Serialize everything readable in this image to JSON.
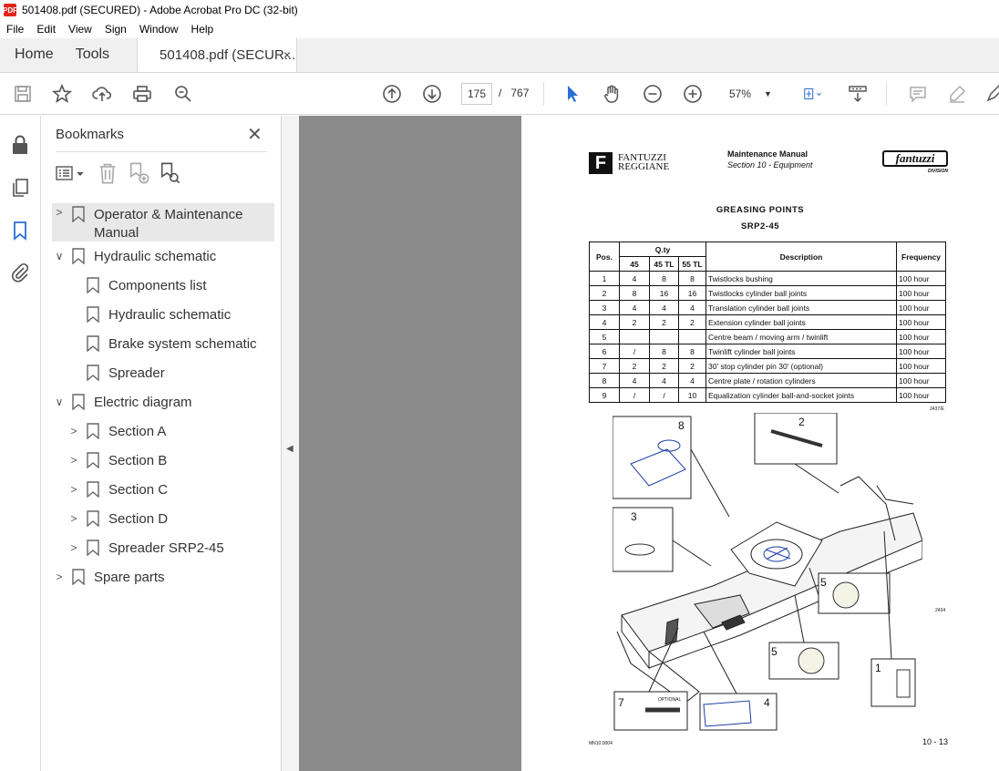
{
  "window": {
    "title": "501408.pdf (SECURED) - Adobe Acrobat Pro DC (32-bit)",
    "logo_text": "PDF"
  },
  "menu": [
    "File",
    "Edit",
    "View",
    "Sign",
    "Window",
    "Help"
  ],
  "tabs": {
    "home": "Home",
    "tools": "Tools",
    "document": "501408.pdf (SECUR...",
    "close": "×"
  },
  "toolbar": {
    "current_page": "175",
    "page_separator": "/",
    "total_pages": "767",
    "zoom": "57%"
  },
  "bookmarks_panel": {
    "title": "Bookmarks",
    "close": "✕",
    "items": [
      {
        "label": "Operator & Maintenance Manual",
        "level": 0,
        "expander": "collapsed",
        "selected": true
      },
      {
        "label": "Hydraulic schematic",
        "level": 0,
        "expander": "expanded",
        "selected": false
      },
      {
        "label": "Components list",
        "level": 1,
        "expander": "none",
        "selected": false
      },
      {
        "label": "Hydraulic schematic",
        "level": 1,
        "expander": "none",
        "selected": false
      },
      {
        "label": "Brake system schematic",
        "level": 1,
        "expander": "none",
        "selected": false
      },
      {
        "label": "Spreader",
        "level": 1,
        "expander": "none",
        "selected": false
      },
      {
        "label": "Electric diagram",
        "level": 0,
        "expander": "expanded",
        "selected": false
      },
      {
        "label": "Section A",
        "level": 1,
        "expander": "collapsed",
        "selected": false
      },
      {
        "label": "Section B",
        "level": 1,
        "expander": "collapsed",
        "selected": false
      },
      {
        "label": "Section C",
        "level": 1,
        "expander": "collapsed",
        "selected": false
      },
      {
        "label": "Section D",
        "level": 1,
        "expander": "collapsed",
        "selected": false
      },
      {
        "label": "Spreader SRP2-45",
        "level": 1,
        "expander": "collapsed",
        "selected": false
      },
      {
        "label": "Spare parts",
        "level": 0,
        "expander": "collapsed",
        "selected": false
      }
    ]
  },
  "pdf_page": {
    "company_line1": "FANTUZZI",
    "company_line2": "REGGIANE",
    "logo_letter": "F",
    "manual": "Maintenance Manual",
    "section": "Section 10 - Equipment",
    "brand": "fantuzzi",
    "division": "DIVISION",
    "title": "GREASING POINTS",
    "subtitle": "SRP2-45",
    "table": {
      "col_pos": "Pos.",
      "col_qty": "Q.ty",
      "qty_sub": [
        "45",
        "45 TL",
        "55 TL"
      ],
      "col_desc": "Description",
      "col_freq": "Frequency",
      "rows": [
        [
          "1",
          "4",
          "8",
          "8",
          "Twistlocks bushing",
          "100 hour"
        ],
        [
          "2",
          "8",
          "16",
          "16",
          "Twistlocks cylinder ball joints",
          "100 hour"
        ],
        [
          "3",
          "4",
          "4",
          "4",
          "Translation cylinder ball joints",
          "100 hour"
        ],
        [
          "4",
          "2",
          "2",
          "2",
          "Extension cylinder ball joints",
          "100 hour"
        ],
        [
          "5",
          "",
          "",
          "",
          "Centre beam / moving arm / twinlift",
          "100 hour"
        ],
        [
          "6",
          "/",
          "8",
          "8",
          "Twinlift cylinder ball joints",
          "100 hour"
        ],
        [
          "7",
          "2",
          "2",
          "2",
          "30' stop cylinder pin 30' (optional)",
          "100 hour"
        ],
        [
          "8",
          "4",
          "4",
          "4",
          "Centre plate / rotation cylinders",
          "100 hour"
        ],
        [
          "9",
          "/",
          "/",
          "10",
          "Equalization cylinder ball-and-socket joints",
          "100 hour"
        ]
      ]
    },
    "table_ref": "2437/E",
    "drawing_ref": "2434",
    "callouts": [
      "8",
      "2",
      "3",
      "5",
      "5",
      "1",
      "7",
      "4"
    ],
    "optional_label": "OPTIONAL",
    "footer_left": "MN10.0004",
    "footer_right": "10 - 13"
  }
}
